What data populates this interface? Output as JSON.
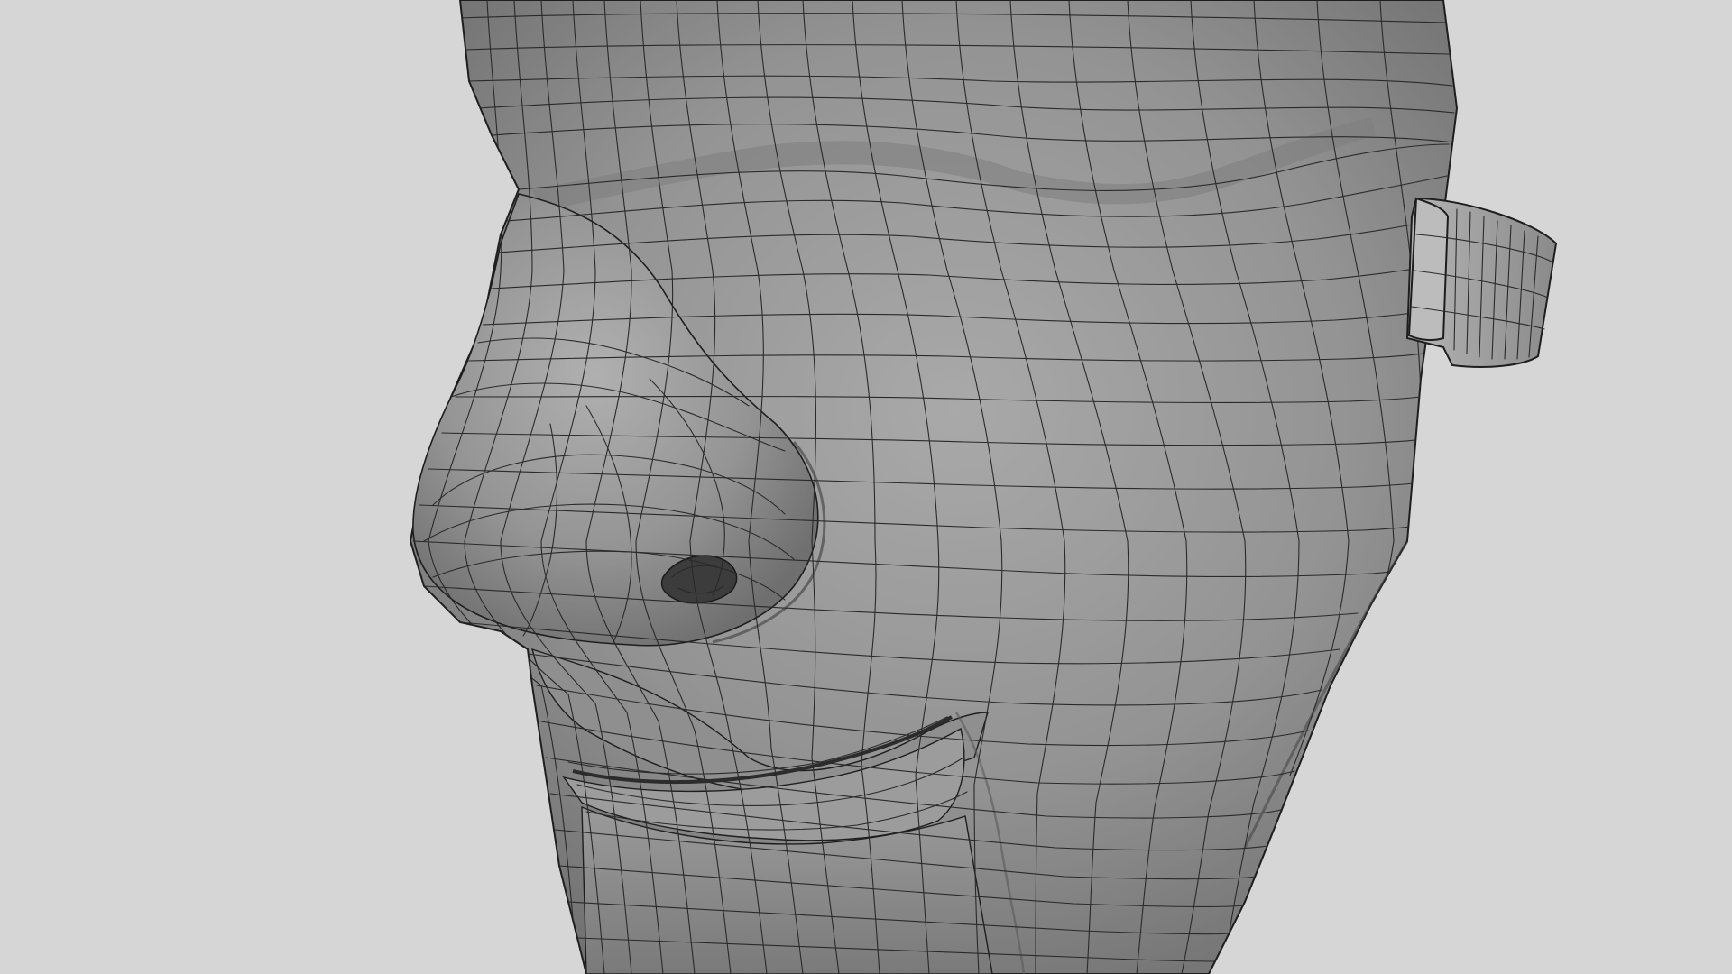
{
  "scene": {
    "background_color": "#d6d6d6",
    "mesh_color": "#8e8e8e",
    "wireframe_color": "#2a2a2a",
    "display_mode": "wireframe-on-shaded",
    "subject": "head-mesh"
  }
}
